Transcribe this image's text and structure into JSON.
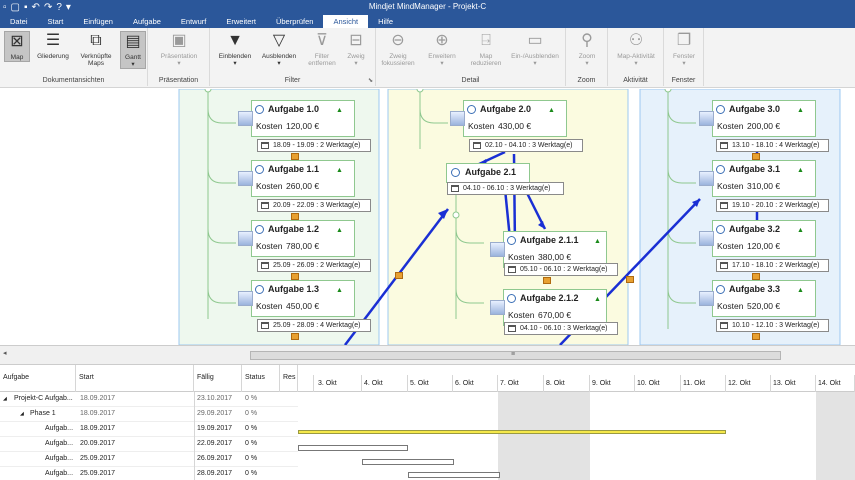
{
  "window": {
    "title": "Mindjet MindManager - Projekt-C",
    "qat_icons": [
      "new-doc-icon",
      "open-icon",
      "save-icon",
      "undo-icon",
      "redo-icon",
      "help-icon",
      "customize-icon"
    ]
  },
  "tabs": [
    {
      "label": "Datei",
      "active": false
    },
    {
      "label": "Start",
      "active": false
    },
    {
      "label": "Einfügen",
      "active": false
    },
    {
      "label": "Aufgabe",
      "active": false
    },
    {
      "label": "Entwurf",
      "active": false
    },
    {
      "label": "Erweitert",
      "active": false
    },
    {
      "label": "Überprüfen",
      "active": false
    },
    {
      "label": "Ansicht",
      "active": true
    },
    {
      "label": "Hilfe",
      "active": false
    }
  ],
  "ribbon": {
    "groups": {
      "dokumentansichten": "Dokumentansichten",
      "praesentation": "Präsentation",
      "filter": "Filter",
      "detail": "Detail",
      "zoom": "Zoom",
      "aktivitaet": "Aktivität",
      "fenster": "Fenster"
    },
    "buttons": {
      "map": "Map",
      "gliederung": "Gliederung",
      "verknuepfte_1": "Verknüpfte",
      "verknuepfte_2": "Maps",
      "gantt": "Gantt",
      "praesentation": "Präsentation",
      "einblenden": "Einblenden",
      "ausblenden": "Ausblenden",
      "filter_entfernen_1": "Filter",
      "filter_entfernen_2": "entfernen",
      "zweig": "Zweig",
      "zweig_fokussieren_1": "Zweig",
      "zweig_fokussieren_2": "fokussieren",
      "erweitern": "Erweitern",
      "map_reduzieren_1": "Map",
      "map_reduzieren_2": "reduzieren",
      "ein_ausblenden": "Ein-/Ausblenden",
      "zoom": "Zoom",
      "map_aktivitaet": "Map-Aktivität",
      "fenster": "Fenster"
    }
  },
  "map": {
    "tasks": [
      {
        "name": "Aufgabe 1.0",
        "cost_label": "Kosten",
        "cost": "120,00 €",
        "date": "18.09 - 19.09 : 2 Werktag(e)"
      },
      {
        "name": "Aufgabe 1.1",
        "cost_label": "Kosten",
        "cost": "260,00 €",
        "date": "20.09 - 22.09 : 3 Werktag(e)"
      },
      {
        "name": "Aufgabe 1.2",
        "cost_label": "Kosten",
        "cost": "780,00 €",
        "date": "25.09 - 26.09 : 2 Werktag(e)"
      },
      {
        "name": "Aufgabe 1.3",
        "cost_label": "Kosten",
        "cost": "450,00 €",
        "date": "25.09 - 28.09 : 4 Werktag(e)"
      },
      {
        "name": "Aufgabe 2.0",
        "cost_label": "Kosten",
        "cost": "430,00 €",
        "date": "02.10 - 04.10 : 3 Werktag(e)"
      },
      {
        "name": "Aufgabe 2.1.1",
        "cost_label": "Kosten",
        "cost": "380,00 €",
        "date": "05.10 - 06.10 : 2 Werktag(e)"
      },
      {
        "name": "Aufgabe 2.1.2",
        "cost_label": "Kosten",
        "cost": "670,00 €",
        "date": "04.10 - 06.10 : 3 Werktag(e)"
      },
      {
        "name": "Aufgabe 3.0",
        "cost_label": "Kosten",
        "cost": "200,00 €",
        "date": "13.10 - 18.10 : 4 Werktag(e)"
      },
      {
        "name": "Aufgabe 3.1",
        "cost_label": "Kosten",
        "cost": "310,00 €",
        "date": "19.10 - 20.10 : 2 Werktag(e)"
      },
      {
        "name": "Aufgabe 3.2",
        "cost_label": "Kosten",
        "cost": "120,00 €",
        "date": "17.10 - 18.10 : 2 Werktag(e)"
      },
      {
        "name": "Aufgabe 3.3",
        "cost_label": "Kosten",
        "cost": "520,00 €",
        "date": "10.10 - 12.10 : 3 Werktag(e)"
      }
    ],
    "subtopic": {
      "name": "Aufgabe 2.1",
      "date": "04.10 - 06.10 : 3 Werktag(e)"
    }
  },
  "gantt": {
    "columns": {
      "task": "Aufgabe",
      "start": "Start",
      "due": "Fällig",
      "status": "Status",
      "res": "Res"
    },
    "days": [
      "3. Okt",
      "4. Okt",
      "5. Okt",
      "6. Okt",
      "7. Okt",
      "8. Okt",
      "9. Okt",
      "10. Okt",
      "11. Okt",
      "12. Okt",
      "13. Okt",
      "14. Okt"
    ],
    "rows": [
      {
        "task": "Projekt-C Aufgab...",
        "start": "18.09.2017",
        "due": "23.10.2017",
        "status": "0 %",
        "toggle": "◢"
      },
      {
        "task": "Phase 1",
        "start": "18.09.2017",
        "due": "29.09.2017",
        "status": "0 %",
        "toggle": "◢"
      },
      {
        "task": "Aufgab...",
        "start": "18.09.2017",
        "due": "19.09.2017",
        "status": "0 %",
        "toggle": ""
      },
      {
        "task": "Aufgab...",
        "start": "20.09.2017",
        "due": "22.09.2017",
        "status": "0 %",
        "toggle": ""
      },
      {
        "task": "Aufgab...",
        "start": "25.09.2017",
        "due": "26.09.2017",
        "status": "0 %",
        "toggle": ""
      },
      {
        "task": "Aufgab...",
        "start": "25.09.2017",
        "due": "28.09.2017",
        "status": "0 %",
        "toggle": ""
      }
    ]
  },
  "colors": {
    "ribbon_blue": "#2b579a",
    "link_blue": "#1a2fd4",
    "branch1_bg": "#eef8ee",
    "branch2_bg": "#fbfbe0",
    "branch3_bg": "#e6f1fb"
  }
}
